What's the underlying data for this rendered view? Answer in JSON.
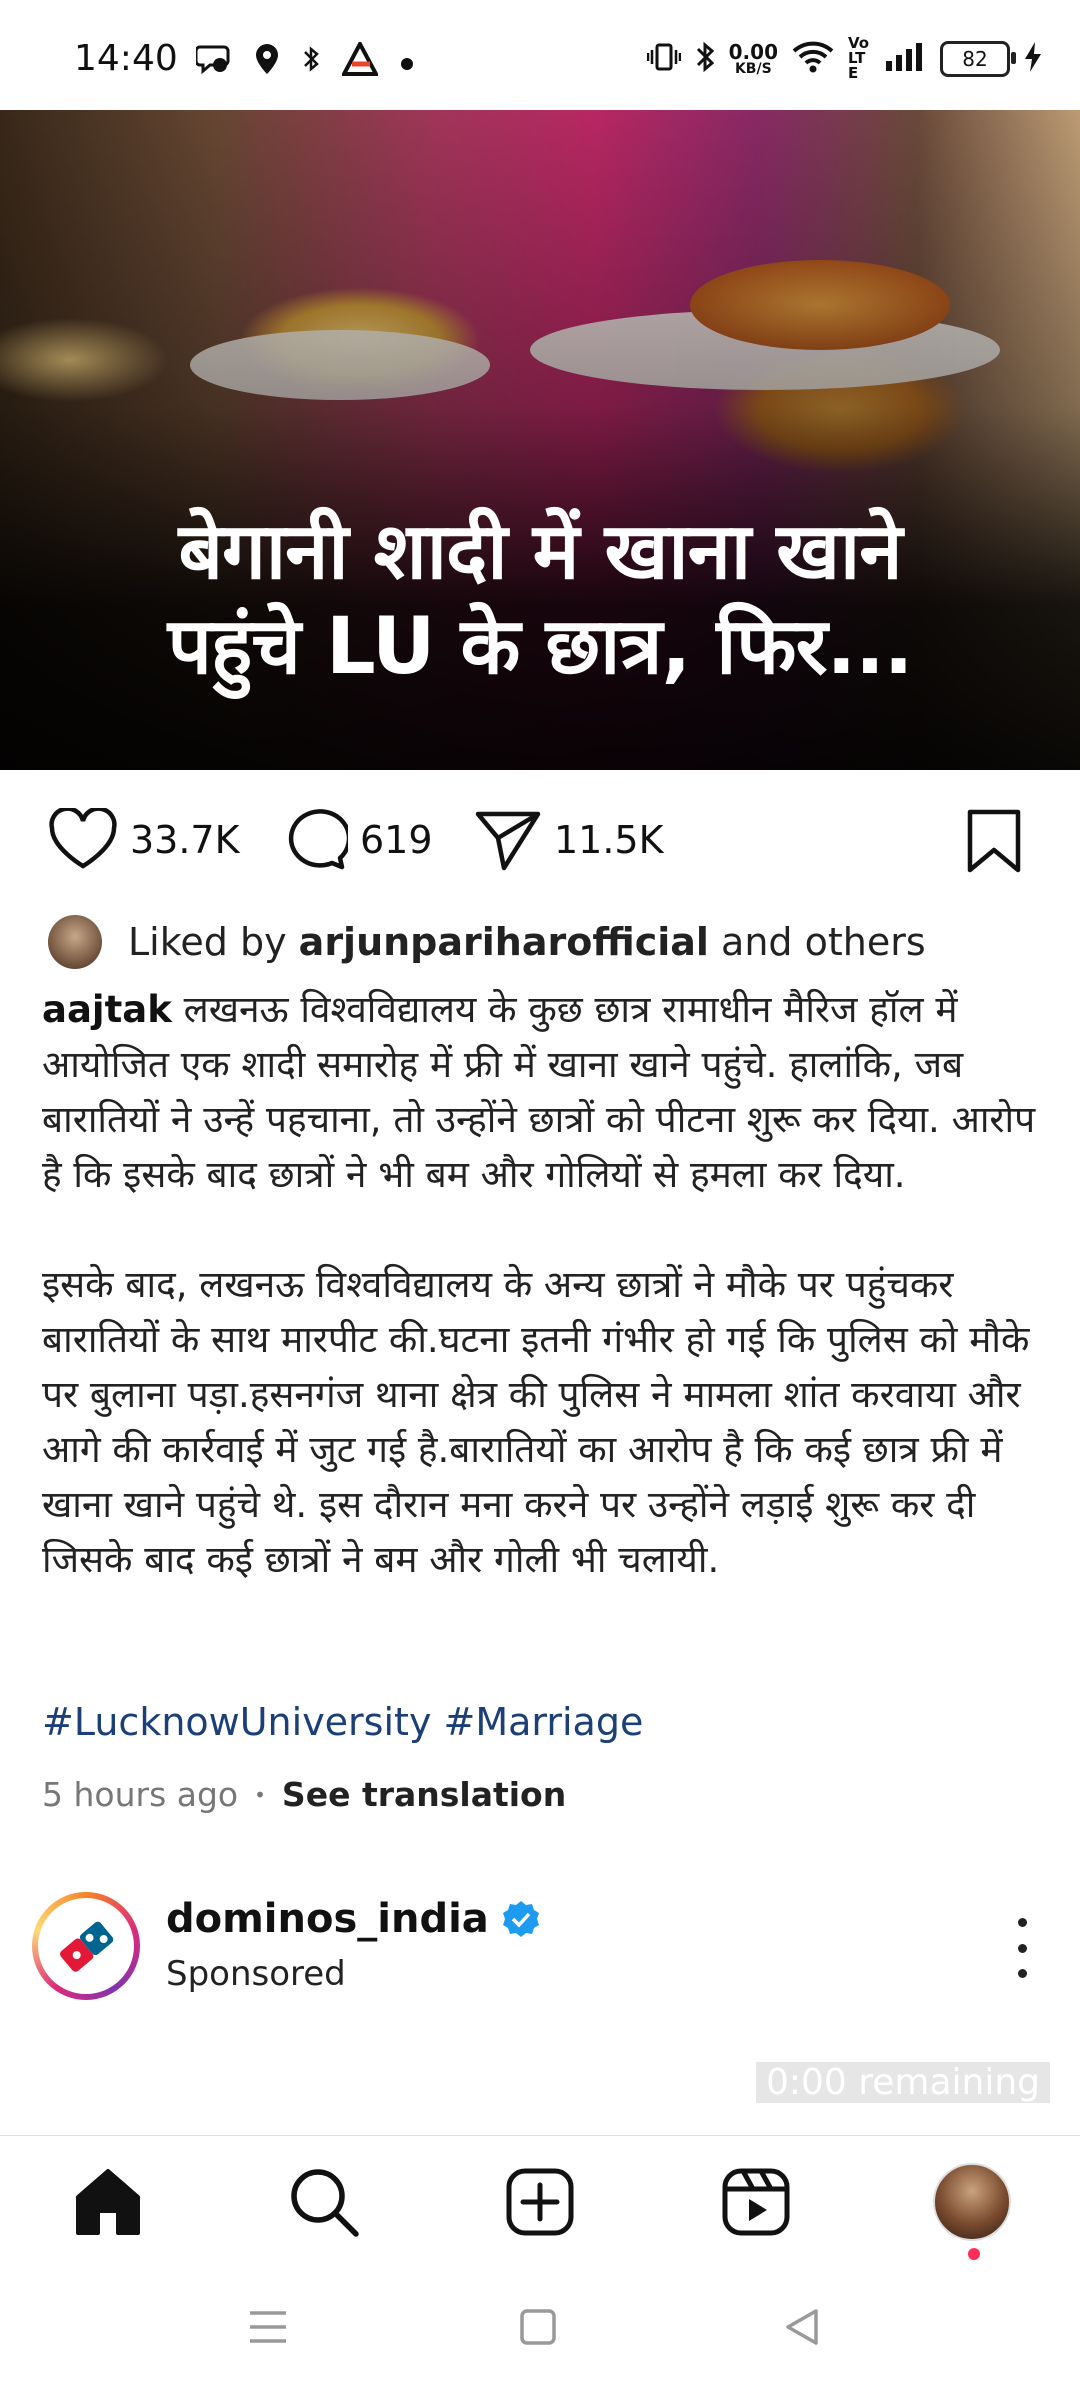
{
  "status_bar": {
    "time": "14:40",
    "net_speed_value": "0.00",
    "net_speed_unit": "KB/S",
    "volte": "Vo LTE",
    "battery": "82",
    "left_icons": [
      "chat-bubble-icon",
      "location-icon",
      "bluetooth-small-icon",
      "app-logo-icon",
      "dot-icon"
    ],
    "right_icons": [
      "vibrate-icon",
      "bluetooth-icon",
      "wifi-icon",
      "signal-icon",
      "charging-icon"
    ]
  },
  "post": {
    "headline_line1": "बेगानी शादी में खाना खाने",
    "headline_line2": "पहुंचे LU के छात्र, फिर...",
    "likes_count": "33.7K",
    "comments_count": "619",
    "shares_count": "11.5K",
    "liked_by_prefix": "Liked by",
    "liked_by_user": "arjunpariharofficial",
    "liked_by_suffix": "and others",
    "author": "aajtak",
    "caption_p1": "लखनऊ विश्वविद्यालय के कुछ छात्र रामाधीन मैरिज हॉल में आयोजित एक शादी समारोह में फ्री में खाना खाने पहुंचे. हालांकि, जब बारातियों ने उन्हें पहचाना, तो उन्होंने छात्रों को पीटना शुरू कर दिया. आरोप है कि इसके बाद छात्रों ने भी बम और गोलियों से हमला कर दिया.",
    "caption_p2": "इसके बाद, लखनऊ विश्वविद्यालय के अन्य छात्रों ने मौके पर पहुंचकर बारातियों के साथ मारपीट की.घटना इतनी गंभीर हो गई कि पुलिस को मौके पर बुलाना पड़ा.हसनगंज थाना क्षेत्र की पुलिस ने मामला शांत करवाया और आगे की कार्रवाई में जुट गई है.बारातियों का आरोप है कि कई छात्र फ्री में खाना खाने पहुंचे थे. इस दौरान मना करने पर उन्होंने लड़ाई शुरू कर दी जिसके बाद कई छात्रों ने बम और गोली भी चलायी.",
    "hashtags": "#LucknowUniversity #Marriage",
    "time_ago": "5 hours ago",
    "separator": "•",
    "see_translation": "See translation"
  },
  "sponsored": {
    "account": "dominos_india",
    "label": "Sponsored",
    "remaining": "0:00 remaining"
  },
  "bottom_nav": [
    "home-icon",
    "search-icon",
    "create-icon",
    "reels-icon",
    "profile-avatar"
  ],
  "colors": {
    "hashtag": "#1c3f78",
    "verified": "#1d9bf0",
    "notification": "#ff2d55"
  }
}
